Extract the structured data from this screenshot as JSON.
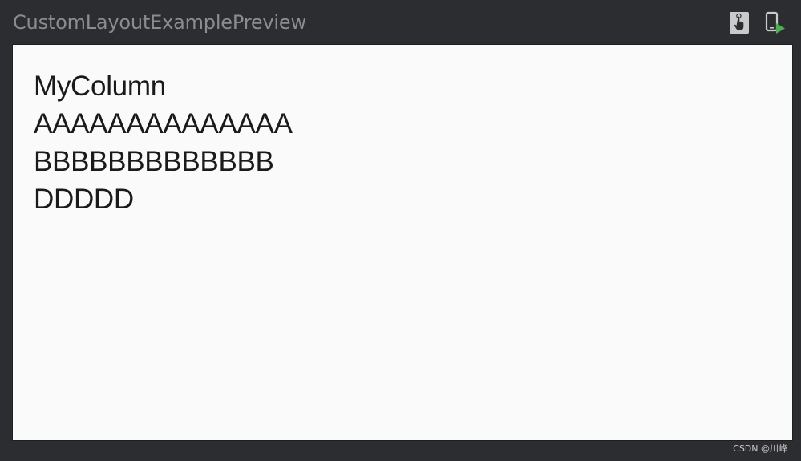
{
  "preview": {
    "title": "CustomLayoutExamplePreview"
  },
  "toolbar": {
    "interactive_mode_icon": "hand-pointer-icon",
    "deploy_preview_icon": "device-run-icon",
    "accent_color": "#4caf50"
  },
  "column": {
    "items": [
      {
        "text": "MyColumn"
      },
      {
        "text": "AAAAAAAAAAAAAA"
      },
      {
        "text": "BBBBBBBBBBBBB"
      },
      {
        "text": "DDDDD"
      }
    ]
  },
  "watermark": {
    "text": "CSDN @川峰"
  }
}
